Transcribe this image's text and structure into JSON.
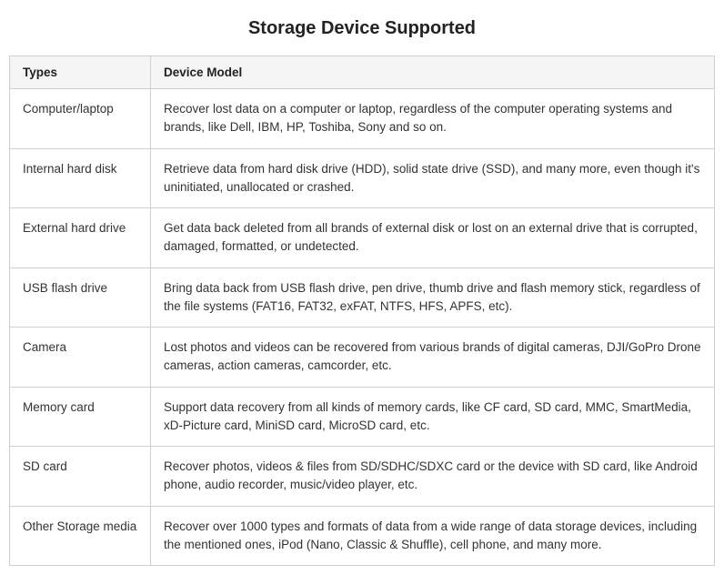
{
  "page": {
    "title": "Storage Device Supported"
  },
  "table": {
    "headers": [
      "Types",
      "Device Model"
    ],
    "rows": [
      {
        "type": "Computer/laptop",
        "description": "Recover lost data on a computer or laptop, regardless of the computer operating systems and brands, like Dell, IBM, HP, Toshiba, Sony and so on."
      },
      {
        "type": "Internal hard disk",
        "description": "Retrieve data from hard disk drive (HDD), solid state drive (SSD), and many more, even though it's uninitiated, unallocated or crashed."
      },
      {
        "type": "External hard drive",
        "description": "Get data back deleted from all brands of external disk or lost on an external drive that is corrupted, damaged, formatted, or undetected."
      },
      {
        "type": "USB flash drive",
        "description": "Bring data back from USB flash drive, pen drive, thumb drive and flash memory stick, regardless of the file systems (FAT16, FAT32, exFAT, NTFS, HFS, APFS, etc)."
      },
      {
        "type": "Camera",
        "description": "Lost photos and videos can be recovered from various brands of digital cameras, DJI/GoPro Drone cameras, action cameras, camcorder, etc."
      },
      {
        "type": "Memory card",
        "description": "Support data recovery from all kinds of memory cards, like CF card, SD card, MMC, SmartMedia, xD-Picture card, MiniSD card, MicroSD card, etc."
      },
      {
        "type": "SD card",
        "description": "Recover photos, videos & files from SD/SDHC/SDXC card or the device with SD card, like Android phone, audio recorder, music/video player, etc."
      },
      {
        "type": "Other Storage media",
        "description": "Recover over 1000 types and formats of data from a wide range of data storage devices, including the mentioned ones, iPod (Nano, Classic & Shuffle), cell phone, and many more."
      }
    ]
  }
}
